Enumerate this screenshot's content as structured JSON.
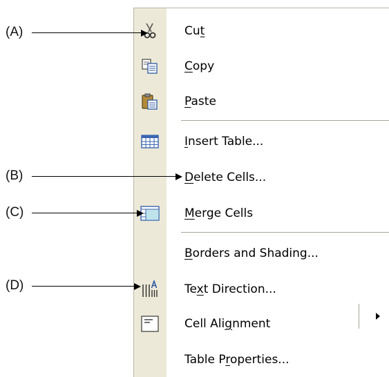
{
  "menu": {
    "items": [
      {
        "icon": "scissors-icon",
        "pre": "Cu",
        "mn": "t",
        "post": ""
      },
      {
        "icon": "copy-icon",
        "pre": "",
        "mn": "C",
        "post": "opy"
      },
      {
        "icon": "paste-icon",
        "pre": "",
        "mn": "P",
        "post": "aste"
      },
      {
        "icon": "insert-table-icon",
        "pre": "",
        "mn": "I",
        "post": "nsert Table..."
      },
      {
        "icon": "",
        "pre": "",
        "mn": "D",
        "post": "elete Cells..."
      },
      {
        "icon": "merge-cells-icon",
        "pre": "",
        "mn": "M",
        "post": "erge Cells"
      },
      {
        "icon": "",
        "pre": "",
        "mn": "B",
        "post": "orders and Shading..."
      },
      {
        "icon": "text-direction-icon",
        "pre": "Te",
        "mn": "x",
        "post": "t Direction..."
      },
      {
        "icon": "cell-alignment-icon",
        "pre": "Cell Ali",
        "mn": "g",
        "post": "nment"
      },
      {
        "icon": "",
        "pre": "Table P",
        "mn": "r",
        "post": "operties..."
      }
    ]
  },
  "callouts": [
    {
      "label": "(A)"
    },
    {
      "label": "(B)"
    },
    {
      "label": "(C)"
    },
    {
      "label": "(D)"
    }
  ],
  "colors": {
    "gutter": "#ece9d8",
    "separator": "#a6a49a",
    "icon_blue": "#3a66b0",
    "cell_fill": "#bfe3ea"
  }
}
